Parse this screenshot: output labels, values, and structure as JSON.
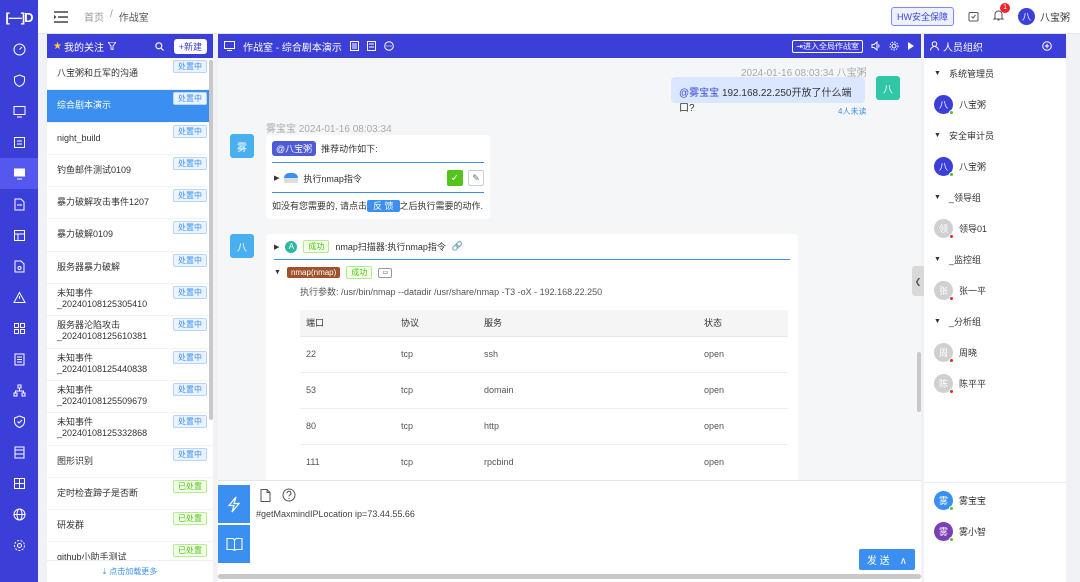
{
  "app": {
    "logo_text": "[—]D",
    "breadcrumb": [
      "首页",
      "/",
      "作战室"
    ]
  },
  "topbar": {
    "hw_label": "HW安全保障",
    "bell_count": "1",
    "user_avatar": "八",
    "user_name": "八宝粥"
  },
  "nav_icons": [
    "dashboard-icon",
    "shield-icon",
    "monitor-icon",
    "list-icon",
    "warroom-icon",
    "document-icon",
    "table-icon",
    "file-icon",
    "alert-icon",
    "grid-icon",
    "report-icon",
    "org-icon",
    "security-icon",
    "book-icon",
    "database-icon",
    "globe-icon",
    "settings-icon"
  ],
  "left_panel": {
    "title": "我的关注",
    "new_button": "+新建",
    "load_more": "点击加载更多",
    "items": [
      {
        "name": "八宝粥和丘军的沟通",
        "status": "处置中",
        "state": "doing",
        "active": false,
        "two": false
      },
      {
        "name": "综合剧本演示",
        "status": "处置中",
        "state": "doing",
        "active": true,
        "two": false
      },
      {
        "name": "night_build",
        "status": "处置中",
        "state": "doing",
        "active": false,
        "two": false
      },
      {
        "name": "钓鱼邮件测试0109",
        "status": "处置中",
        "state": "doing",
        "active": false,
        "two": false
      },
      {
        "name": "暴力破解攻击事件1207",
        "status": "处置中",
        "state": "doing",
        "active": false,
        "two": false
      },
      {
        "name": "暴力破解0109",
        "status": "处置中",
        "state": "doing",
        "active": false,
        "two": false
      },
      {
        "name": "服务器暴力破解",
        "status": "处置中",
        "state": "doing",
        "active": false,
        "two": false
      },
      {
        "name": "未知事件_20240108125305410",
        "status": "处置中",
        "state": "doing",
        "active": false,
        "two": true
      },
      {
        "name": "服务器沦陷攻击_20240108125610381",
        "status": "处置中",
        "state": "doing",
        "active": false,
        "two": true
      },
      {
        "name": "未知事件_20240108125440838",
        "status": "处置中",
        "state": "doing",
        "active": false,
        "two": true
      },
      {
        "name": "未知事件_20240108125509679",
        "status": "处置中",
        "state": "doing",
        "active": false,
        "two": true
      },
      {
        "name": "未知事件_20240108125332868",
        "status": "处置中",
        "state": "doing",
        "active": false,
        "two": true
      },
      {
        "name": "图形识别",
        "status": "处置中",
        "state": "doing",
        "active": false,
        "two": false
      },
      {
        "name": "定时检查蹄子是否断",
        "status": "已处置",
        "state": "done",
        "active": false,
        "two": false
      },
      {
        "name": "研发群",
        "status": "已处置",
        "state": "done",
        "active": false,
        "two": false
      },
      {
        "name": "github小助手测试",
        "status": "已处置",
        "state": "done",
        "active": false,
        "two": false
      }
    ]
  },
  "chat": {
    "title": "作战室 - 综合剧本演示",
    "enter_global": "进入全局作战室",
    "msg1": {
      "timestamp": "2024-01-16 08:03:34 八宝粥",
      "mention": "@雾宝宝",
      "text": "192.168.22.250开放了什么端口?",
      "unread": "4人未读",
      "avatar": "八"
    },
    "msg2": {
      "timestamp": "雾宝宝 2024-01-16 08:03:34",
      "avatar": "雾",
      "mention": "@八宝粥",
      "intro": "推荐动作如下:",
      "action": "执行nmap指令",
      "hint_before": "如没有您需要的, 请点击",
      "feedback": "反 馈",
      "hint_after": "之后执行需要的动作."
    },
    "msg3": {
      "avatar": "八",
      "app_letter": "A",
      "status": "成功",
      "title": "nmap扫描器:执行nmap指令",
      "sub_tag": "nmap(nmap)",
      "sub_status": "成功",
      "params": "执行参数: /usr/bin/nmap --datadir /usr/share/nmap -T3 -oX - 192.168.22.250",
      "table_headers": [
        "端口",
        "协议",
        "服务",
        "状态"
      ],
      "rows": [
        [
          "22",
          "tcp",
          "ssh",
          "open"
        ],
        [
          "53",
          "tcp",
          "domain",
          "open"
        ],
        [
          "80",
          "tcp",
          "http",
          "open"
        ],
        [
          "111",
          "tcp",
          "rpcbind",
          "open"
        ]
      ]
    },
    "input_text": "#getMaxmindIPLocation ip=73.44.55.66",
    "send_label": "发 送"
  },
  "right_panel": {
    "title": "人员组织",
    "groups": [
      {
        "name": "系统管理员",
        "members": [
          {
            "name": "八宝粥",
            "av": "八",
            "color": "#3b3fd8",
            "dot": "#52c41a"
          }
        ]
      },
      {
        "name": "安全审计员",
        "members": [
          {
            "name": "八宝粥",
            "av": "八",
            "color": "#3b3fd8",
            "dot": "#52c41a"
          }
        ]
      },
      {
        "name": "_领导组",
        "members": [
          {
            "name": "领导01",
            "av": "领",
            "color": "#d0d0d0",
            "dot": "#f5222d"
          }
        ]
      },
      {
        "name": "_监控组",
        "members": [
          {
            "name": "张一平",
            "av": "张",
            "color": "#d0d0d0",
            "dot": "#f5222d"
          }
        ]
      },
      {
        "name": "_分析组",
        "members": [
          {
            "name": "周晓",
            "av": "周",
            "color": "#d0d0d0",
            "dot": "#f5222d"
          },
          {
            "name": "陈平平",
            "av": "陈",
            "color": "#d0d0d0",
            "dot": "#f5222d"
          }
        ]
      }
    ],
    "bottom_members": [
      {
        "name": "雾宝宝",
        "av": "雾",
        "color": "#3b8ff0",
        "dot": "#52c41a"
      },
      {
        "name": "雾小智",
        "av": "雾",
        "color": "#7b3fb8",
        "dot": "#52c41a"
      }
    ]
  }
}
